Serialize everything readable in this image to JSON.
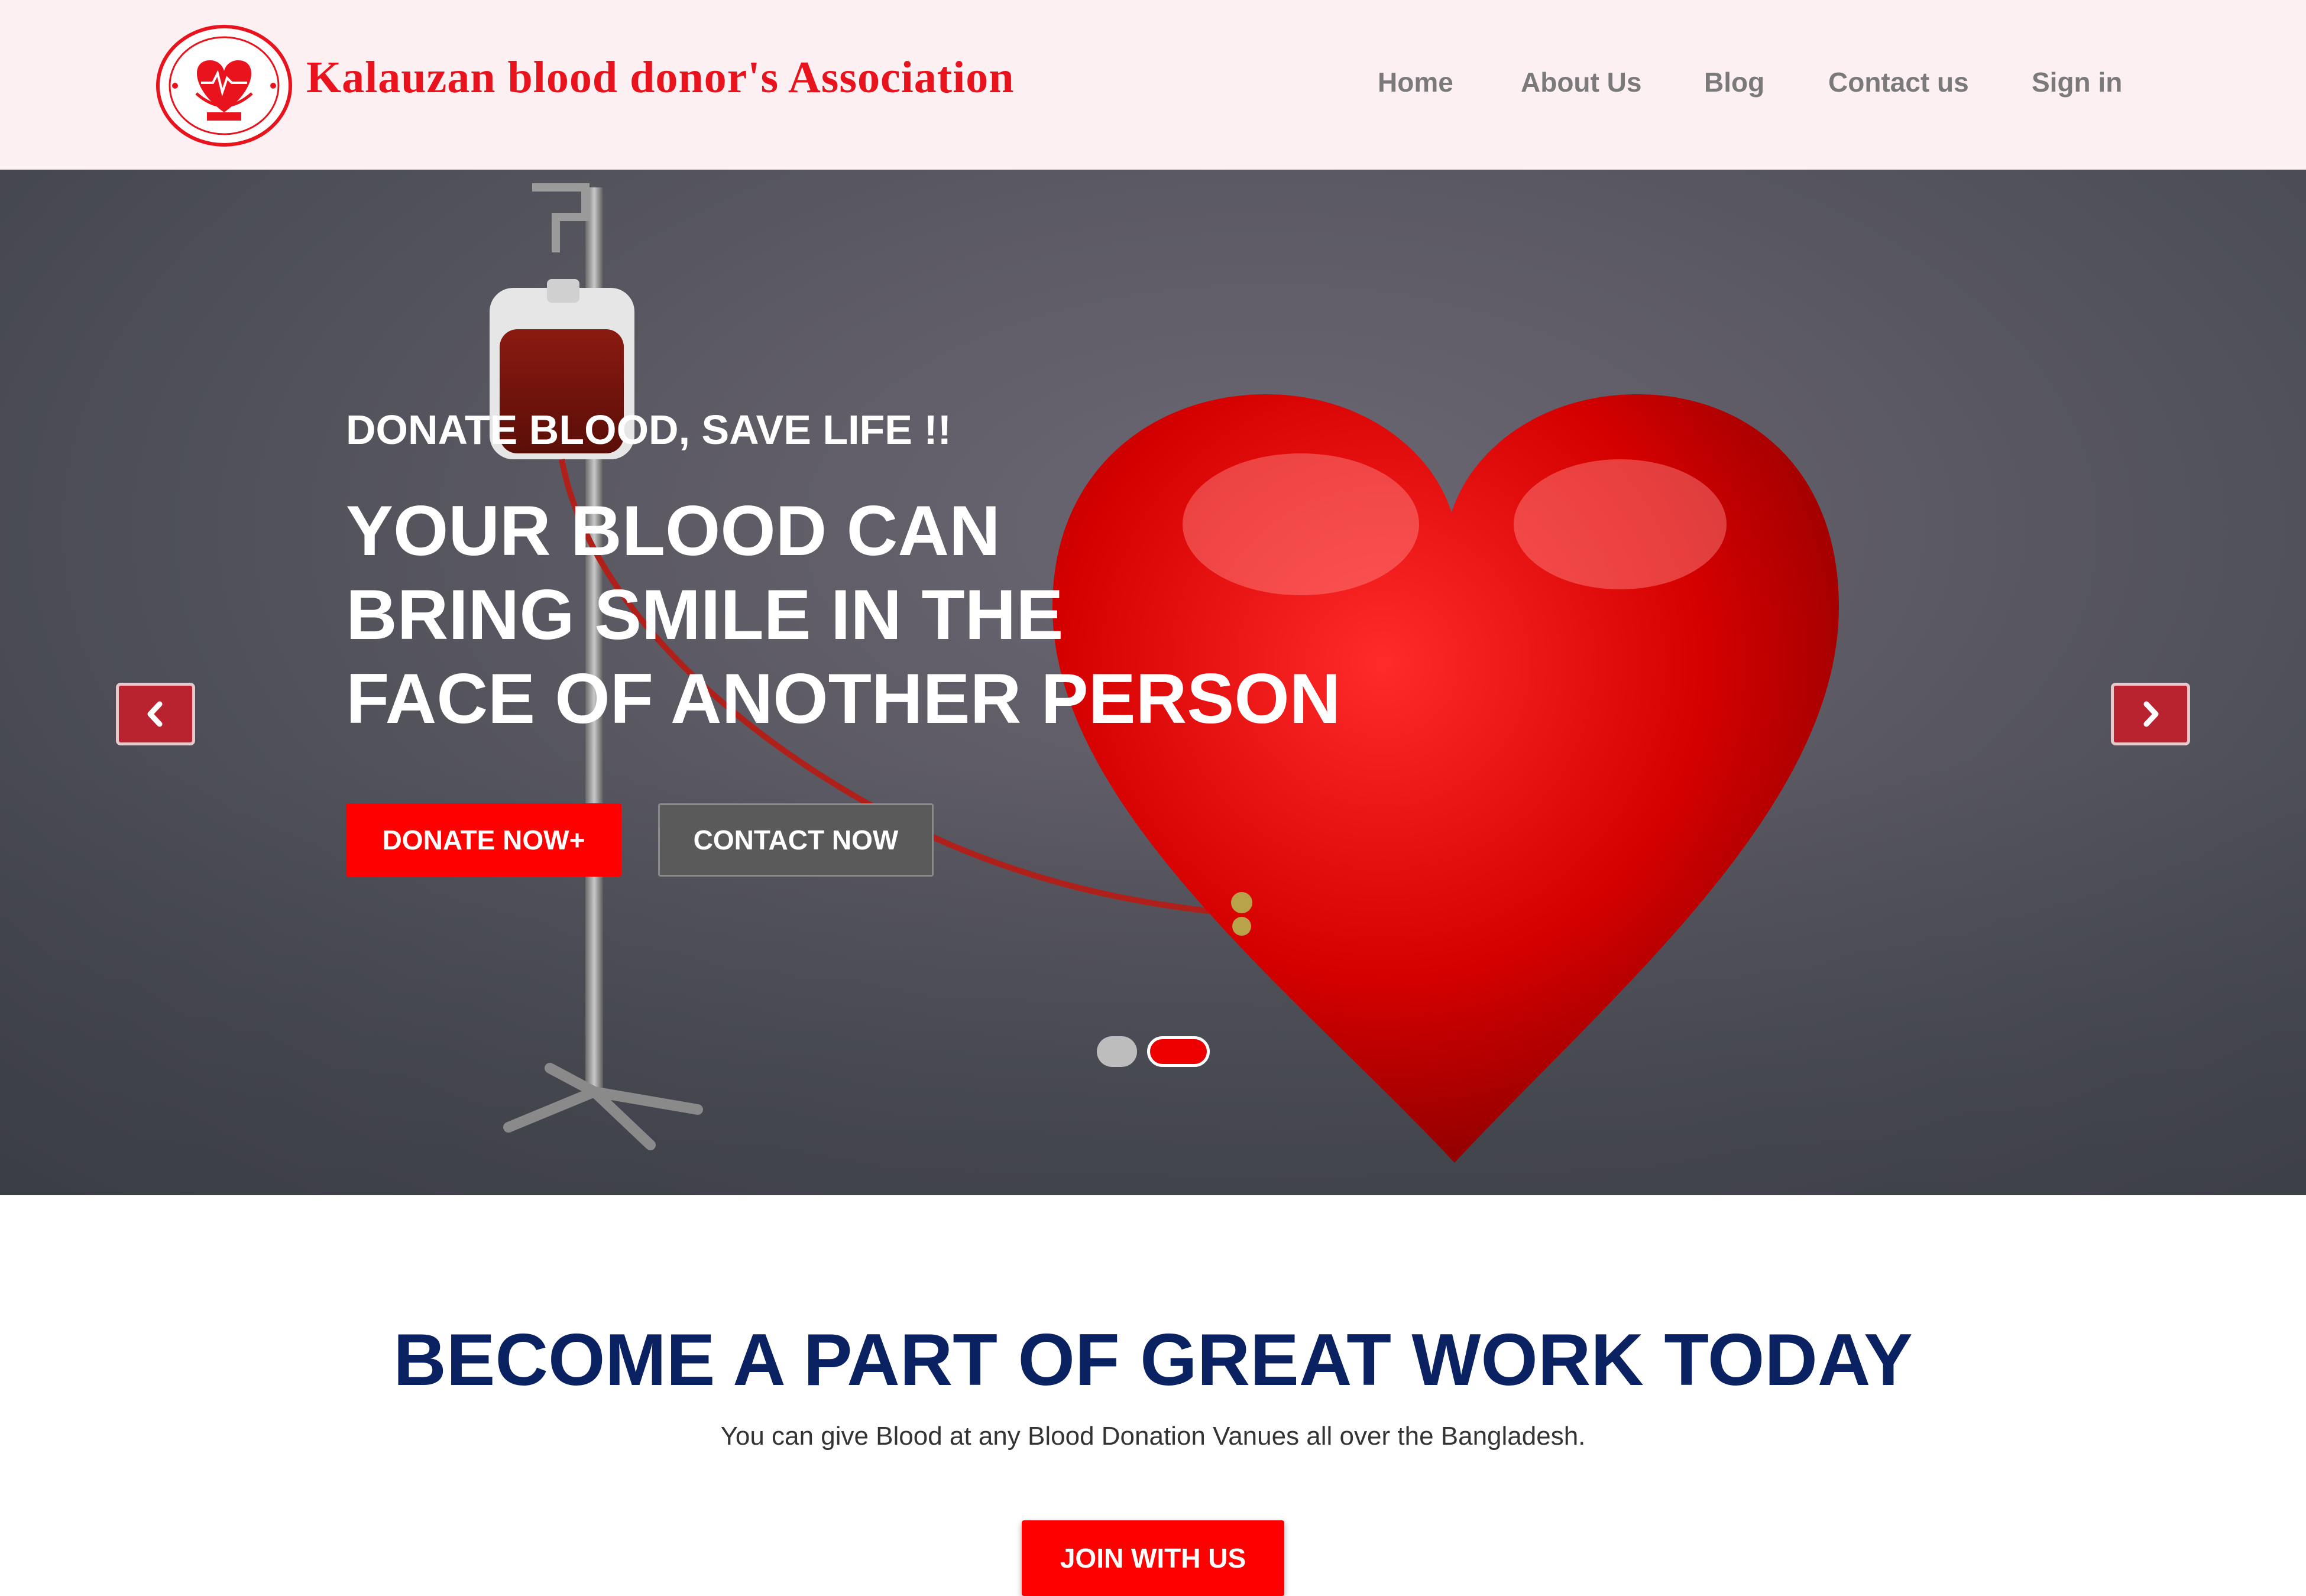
{
  "header": {
    "brand_name": "Kalauzan blood donor's Association",
    "logo_icon": "association-seal-logo",
    "nav": {
      "home": "Home",
      "about": "About Us",
      "blog": "Blog",
      "contact": "Contact us",
      "signin": "Sign in"
    }
  },
  "hero": {
    "subtitle": "DONATE BLOOD, SAVE LIFE !!",
    "title_lines": [
      "YOUR BLOOD CAN",
      "BRING SMILE IN THE",
      "FACE OF ANOTHER PERSON"
    ],
    "donate_button": "DONATE NOW+",
    "contact_button": "CONTACT NOW",
    "prev_icon": "chevron-left-icon",
    "next_icon": "chevron-right-icon",
    "slide_count": 2,
    "active_slide": 2
  },
  "cta_section": {
    "title": "BECOME A PART OF GREAT WORK TODAY",
    "subtitle": "You can give Blood at any Blood Donation Vanues all over the Bangladesh.",
    "join_button": "JOIN WITH US"
  },
  "colors": {
    "brand_red": "#e8131d",
    "button_red": "#ff0000",
    "heading_navy": "#0b2262",
    "header_bg": "#fdf0f3",
    "nav_gray": "#7a7a7a"
  }
}
